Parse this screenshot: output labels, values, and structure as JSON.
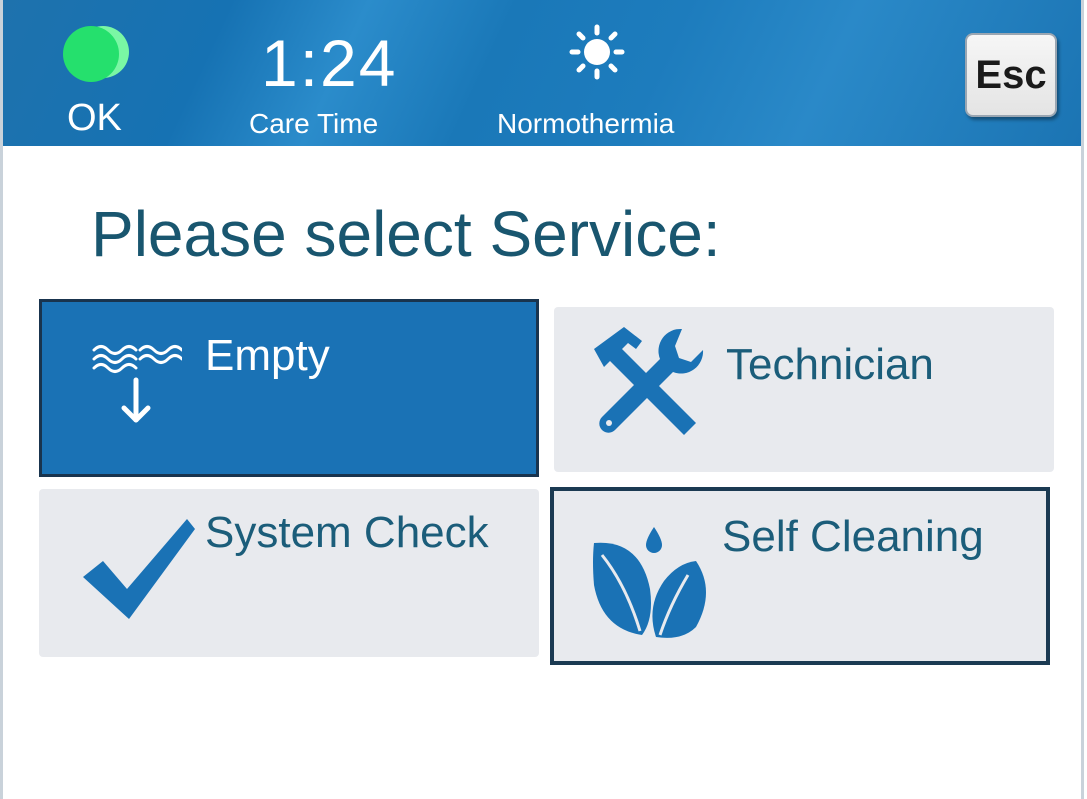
{
  "header": {
    "status_text": "OK",
    "status_color": "#25e06d",
    "care_time": "1:24",
    "care_time_label": "Care Time",
    "mode_icon": "sun-icon",
    "mode_label": "Normothermia",
    "esc_label": "Esc"
  },
  "main": {
    "prompt": "Please select Service:",
    "tiles": [
      {
        "label": "Empty",
        "icon": "drain-icon",
        "state": "selected"
      },
      {
        "label": "Technician",
        "icon": "hammer-wrench-icon",
        "state": "normal"
      },
      {
        "label": "System Check",
        "icon": "checkmark-icon",
        "state": "normal"
      },
      {
        "label": "Self Cleaning",
        "icon": "leaves-drop-icon",
        "state": "focused"
      }
    ]
  },
  "colors": {
    "header_blue": "#1a76b6",
    "accent_blue": "#1a72b5",
    "text_teal": "#19566f",
    "tile_gray": "#e8eaee"
  }
}
